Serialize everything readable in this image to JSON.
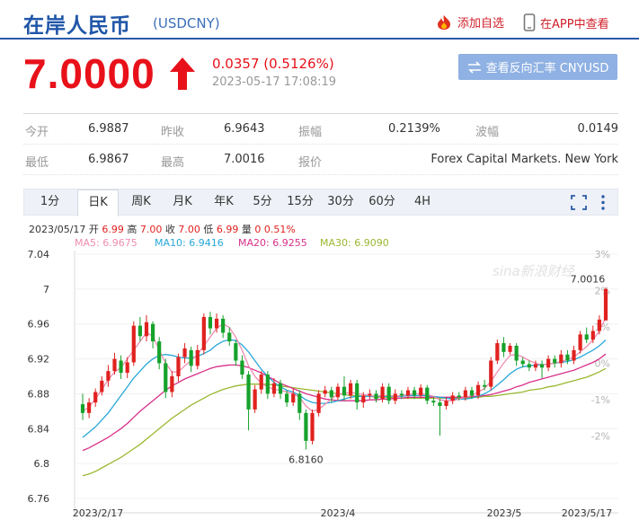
{
  "header": {
    "title": "在岸人民币",
    "code": "(USDCNY)",
    "add_fav_label": "添加自选",
    "app_label": "在APP中查看"
  },
  "quote": {
    "price": "7.0000",
    "change": "0.0357 (0.5126%)",
    "time": "2023-05-17 17:08:19",
    "reverse_button": "查看反向汇率 CNYUSD"
  },
  "stats": [
    [
      {
        "label": "今开",
        "value": "6.9887"
      },
      {
        "label": "昨收",
        "value": "6.9643"
      },
      {
        "label": "振幅",
        "value": "0.2139%"
      },
      {
        "label": "波幅",
        "value": "0.0149"
      }
    ],
    [
      {
        "label": "最低",
        "value": "6.9867"
      },
      {
        "label": "最高",
        "value": "7.0016"
      },
      {
        "label": "报价",
        "value": "Forex Capital Markets. New York"
      }
    ]
  ],
  "tabs": [
    "1分",
    "日K",
    "周K",
    "月K",
    "年K",
    "5分",
    "15分",
    "30分",
    "60分",
    "4H"
  ],
  "active_tab": "日K",
  "info_line": {
    "date": "2023/05/17",
    "open_label": "开",
    "open": "6.99",
    "high_label": "高",
    "high": "7.00",
    "close_label": "收",
    "close": "7.00",
    "low_label": "低",
    "low": "6.99",
    "vol_label": "量",
    "vol": "0",
    "pct": "0.51%"
  },
  "ma_legend": [
    {
      "label": "MA5: 6.9675",
      "color": "#f08cb0"
    },
    {
      "label": "MA10: 6.9416",
      "color": "#28a8d8"
    },
    {
      "label": "MA20: 6.9255",
      "color": "#d8308a"
    },
    {
      "label": "MA30: 6.9090",
      "color": "#9ab830"
    }
  ],
  "watermark": "sina新浪财经",
  "colors": {
    "up": "#e0221f",
    "down": "#16a22b",
    "accent": "#1f56a8"
  },
  "chart_data": {
    "type": "candlestick",
    "yticks": [
      "7.04",
      "7",
      "6.96",
      "6.92",
      "6.88",
      "6.84",
      "6.8",
      "6.76"
    ],
    "yticks_right": [
      "3%",
      "2%",
      "1%",
      "0%",
      "-1%",
      "-2%"
    ],
    "ylim": [
      6.76,
      7.04
    ],
    "xticks": [
      "2023/2/17",
      "2023/4",
      "2023/5",
      "2023/5/17"
    ],
    "annotations": [
      {
        "label": "7.0016"
      },
      {
        "label": "6.8160"
      }
    ],
    "candles": [
      [
        6.868,
        6.858,
        6.88,
        6.85
      ],
      [
        6.858,
        6.87,
        6.875,
        6.852
      ],
      [
        6.87,
        6.882,
        6.886,
        6.865
      ],
      [
        6.882,
        6.895,
        6.9,
        6.878
      ],
      [
        6.895,
        6.906,
        6.913,
        6.888
      ],
      [
        6.906,
        6.92,
        6.927,
        6.902
      ],
      [
        6.918,
        6.904,
        6.924,
        6.897
      ],
      [
        6.904,
        6.916,
        6.922,
        6.898
      ],
      [
        6.916,
        6.958,
        6.963,
        6.912
      ],
      [
        6.958,
        6.946,
        6.968,
        6.94
      ],
      [
        6.946,
        6.962,
        6.97,
        6.94
      ],
      [
        6.96,
        6.94,
        6.963,
        6.932
      ],
      [
        6.94,
        6.915,
        6.945,
        6.908
      ],
      [
        6.915,
        6.882,
        6.92,
        6.875
      ],
      [
        6.882,
        6.9,
        6.906,
        6.876
      ],
      [
        6.9,
        6.922,
        6.926,
        6.894
      ],
      [
        6.922,
        6.932,
        6.938,
        6.915
      ],
      [
        6.93,
        6.912,
        6.934,
        6.905
      ],
      [
        6.912,
        6.93,
        6.936,
        6.908
      ],
      [
        6.93,
        6.968,
        6.972,
        6.925
      ],
      [
        6.968,
        6.955,
        6.974,
        6.948
      ],
      [
        6.955,
        6.966,
        6.972,
        6.95
      ],
      [
        6.966,
        6.95,
        6.97,
        6.944
      ],
      [
        6.95,
        6.94,
        6.956,
        6.935
      ],
      [
        6.938,
        6.918,
        6.942,
        6.912
      ],
      [
        6.918,
        6.902,
        6.924,
        6.897
      ],
      [
        6.902,
        6.862,
        6.906,
        6.838
      ],
      [
        6.862,
        6.885,
        6.89,
        6.858
      ],
      [
        6.885,
        6.902,
        6.906,
        6.88
      ],
      [
        6.902,
        6.88,
        6.906,
        6.874
      ],
      [
        6.88,
        6.892,
        6.898,
        6.876
      ],
      [
        6.892,
        6.88,
        6.896,
        6.874
      ],
      [
        6.88,
        6.87,
        6.884,
        6.865
      ],
      [
        6.87,
        6.88,
        6.886,
        6.866
      ],
      [
        6.88,
        6.858,
        6.884,
        6.85
      ],
      [
        6.858,
        6.826,
        6.862,
        6.816
      ],
      [
        6.826,
        6.858,
        6.862,
        6.822
      ],
      [
        6.858,
        6.88,
        6.884,
        6.854
      ],
      [
        6.88,
        6.884,
        6.889,
        6.876
      ],
      [
        6.884,
        6.876,
        6.888,
        6.87
      ],
      [
        6.876,
        6.888,
        6.892,
        6.872
      ],
      [
        6.888,
        6.878,
        6.9,
        6.872
      ],
      [
        6.878,
        6.892,
        6.896,
        6.874
      ],
      [
        6.892,
        6.87,
        6.896,
        6.862
      ],
      [
        6.87,
        6.878,
        6.882,
        6.864
      ],
      [
        6.878,
        6.88,
        6.885,
        6.874
      ],
      [
        6.88,
        6.874,
        6.884,
        6.87
      ],
      [
        6.874,
        6.888,
        6.892,
        6.87
      ],
      [
        6.888,
        6.872,
        6.892,
        6.868
      ],
      [
        6.872,
        6.88,
        6.885,
        6.868
      ],
      [
        6.88,
        6.878,
        6.884,
        6.874
      ],
      [
        6.878,
        6.884,
        6.888,
        6.874
      ],
      [
        6.884,
        6.878,
        6.888,
        6.874
      ],
      [
        6.878,
        6.887,
        6.891,
        6.875
      ],
      [
        6.887,
        6.872,
        6.89,
        6.868
      ],
      [
        6.872,
        6.87,
        6.876,
        6.866
      ],
      [
        6.87,
        6.866,
        6.874,
        6.832
      ],
      [
        6.866,
        6.872,
        6.876,
        6.862
      ],
      [
        6.872,
        6.878,
        6.882,
        6.868
      ],
      [
        6.878,
        6.876,
        6.882,
        6.872
      ],
      [
        6.876,
        6.884,
        6.888,
        6.872
      ],
      [
        6.884,
        6.878,
        6.888,
        6.874
      ],
      [
        6.878,
        6.89,
        6.894,
        6.874
      ],
      [
        6.89,
        6.888,
        6.896,
        6.884
      ],
      [
        6.888,
        6.918,
        6.922,
        6.884
      ],
      [
        6.918,
        6.938,
        6.942,
        6.914
      ],
      [
        6.938,
        6.928,
        6.945,
        6.922
      ],
      [
        6.928,
        6.935,
        6.938,
        6.925
      ],
      [
        6.935,
        6.918,
        6.938,
        6.912
      ],
      [
        6.918,
        6.914,
        6.922,
        6.91
      ],
      [
        6.914,
        6.91,
        6.918,
        6.906
      ],
      [
        6.91,
        6.914,
        6.918,
        6.906
      ],
      [
        6.914,
        6.91,
        6.918,
        6.898
      ],
      [
        6.91,
        6.92,
        6.924,
        6.906
      ],
      [
        6.92,
        6.915,
        6.924,
        6.91
      ],
      [
        6.915,
        6.925,
        6.93,
        6.91
      ],
      [
        6.925,
        6.918,
        6.93,
        6.914
      ],
      [
        6.918,
        6.93,
        6.935,
        6.914
      ],
      [
        6.93,
        6.948,
        6.952,
        6.926
      ],
      [
        6.948,
        6.942,
        6.956,
        6.938
      ],
      [
        6.942,
        6.952,
        6.958,
        6.938
      ],
      [
        6.952,
        6.965,
        6.97,
        6.948
      ],
      [
        6.964,
        7.0,
        7.0016,
        6.9867
      ]
    ],
    "ma5": [
      6.86,
      6.865,
      6.874,
      6.885,
      6.896,
      6.905,
      6.91,
      6.92,
      6.93,
      6.94,
      6.95,
      6.946,
      6.93,
      6.915,
      6.905,
      6.905,
      6.912,
      6.918,
      6.925,
      6.935,
      6.945,
      6.955,
      6.96,
      6.956,
      6.945,
      6.93,
      6.912,
      6.9,
      6.892,
      6.888,
      6.885,
      6.884,
      6.882,
      6.88,
      6.876,
      6.866,
      6.86,
      6.862,
      6.868,
      6.874,
      6.88,
      6.88,
      6.882,
      6.88,
      6.879,
      6.878,
      6.877,
      6.878,
      6.878,
      6.877,
      6.878,
      6.879,
      6.88,
      6.88,
      6.879,
      6.877,
      6.873,
      6.872,
      6.872,
      6.874,
      6.876,
      6.878,
      6.882,
      6.886,
      6.894,
      6.905,
      6.915,
      6.924,
      6.925,
      6.922,
      6.918,
      6.915,
      6.913,
      6.914,
      6.915,
      6.917,
      6.919,
      6.922,
      6.928,
      6.934,
      6.942,
      6.952,
      6.9675
    ],
    "ma10": [
      6.83,
      6.836,
      6.842,
      6.85,
      6.858,
      6.868,
      6.878,
      6.888,
      6.898,
      6.906,
      6.914,
      6.92,
      6.924,
      6.925,
      6.924,
      6.922,
      6.921,
      6.921,
      6.923,
      6.926,
      6.93,
      6.936,
      6.94,
      6.942,
      6.941,
      6.936,
      6.928,
      6.918,
      6.908,
      6.9,
      6.893,
      6.888,
      6.884,
      6.882,
      6.878,
      6.873,
      6.87,
      6.869,
      6.869,
      6.87,
      6.872,
      6.874,
      6.876,
      6.877,
      6.877,
      6.877,
      6.877,
      6.877,
      6.877,
      6.877,
      6.877,
      6.878,
      6.878,
      6.878,
      6.878,
      6.877,
      6.876,
      6.875,
      6.874,
      6.874,
      6.874,
      6.875,
      6.877,
      6.88,
      6.884,
      6.89,
      6.896,
      6.903,
      6.908,
      6.911,
      6.912,
      6.913,
      6.913,
      6.914,
      6.915,
      6.916,
      6.917,
      6.919,
      6.922,
      6.926,
      6.93,
      6.935,
      6.9416
    ],
    "ma20": [
      6.815,
      6.818,
      6.822,
      6.826,
      6.83,
      6.835,
      6.84,
      6.846,
      6.853,
      6.86,
      6.866,
      6.872,
      6.878,
      6.884,
      6.889,
      6.893,
      6.897,
      6.9,
      6.903,
      6.906,
      6.909,
      6.911,
      6.912,
      6.913,
      6.913,
      6.912,
      6.91,
      6.907,
      6.904,
      6.9,
      6.896,
      6.892,
      6.889,
      6.886,
      6.883,
      6.88,
      6.878,
      6.876,
      6.874,
      6.873,
      6.872,
      6.872,
      6.872,
      6.872,
      6.872,
      6.873,
      6.873,
      6.874,
      6.874,
      6.875,
      6.875,
      6.876,
      6.876,
      6.876,
      6.876,
      6.876,
      6.876,
      6.876,
      6.876,
      6.876,
      6.876,
      6.877,
      6.877,
      6.878,
      6.879,
      6.881,
      6.883,
      6.885,
      6.888,
      6.89,
      6.893,
      6.895,
      6.897,
      6.899,
      6.901,
      6.903,
      6.905,
      6.907,
      6.91,
      6.913,
      6.916,
      6.92,
      6.9255
    ],
    "ma30": [
      6.786,
      6.788,
      6.791,
      6.795,
      6.799,
      6.803,
      6.807,
      6.812,
      6.817,
      6.822,
      6.828,
      6.834,
      6.84,
      6.846,
      6.852,
      6.857,
      6.862,
      6.867,
      6.871,
      6.875,
      6.879,
      6.882,
      6.885,
      6.887,
      6.889,
      6.89,
      6.891,
      6.891,
      6.891,
      6.891,
      6.89,
      6.889,
      6.888,
      6.887,
      6.886,
      6.885,
      6.884,
      6.883,
      6.882,
      6.881,
      6.88,
      6.879,
      6.878,
      6.878,
      6.877,
      6.877,
      6.876,
      6.876,
      6.876,
      6.875,
      6.875,
      6.875,
      6.875,
      6.875,
      6.875,
      6.875,
      6.875,
      6.875,
      6.875,
      6.875,
      6.875,
      6.876,
      6.876,
      6.877,
      6.877,
      6.878,
      6.879,
      6.88,
      6.881,
      6.882,
      6.884,
      6.885,
      6.886,
      6.888,
      6.889,
      6.891,
      6.893,
      6.895,
      6.897,
      6.899,
      6.902,
      6.905,
      6.909
    ]
  }
}
